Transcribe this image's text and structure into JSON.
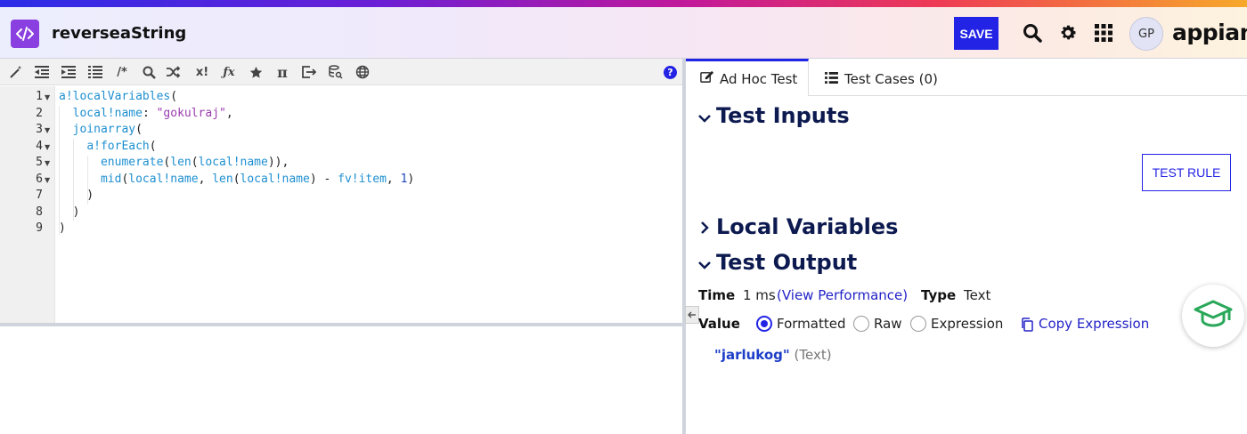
{
  "header": {
    "title": "reverseaString",
    "save_label": "SAVE",
    "avatar_initials": "GP",
    "logo": "appian"
  },
  "toolbar": {
    "icons": [
      "magic-wand-icon",
      "outdent-icon",
      "indent-icon",
      "list-icon",
      "comment-icon",
      "search-icon",
      "shuffle-icon",
      "expression-icon",
      "function-icon",
      "star-icon",
      "pi-icon",
      "export-icon",
      "database-search-icon",
      "globe-icon"
    ],
    "comment_glyph": "/*",
    "expr_glyph": "x!",
    "fx_glyph": "ƒx",
    "pi_glyph": "π",
    "help_glyph": "?"
  },
  "editor": {
    "line_numbers": [
      "1",
      "2",
      "3",
      "4",
      "5",
      "6",
      "7",
      "8",
      "9"
    ],
    "lines": [
      [
        {
          "t": "a!localVariables",
          "c": "kw"
        },
        {
          "t": "(",
          "c": ""
        }
      ],
      [
        {
          "t": "  ",
          "c": ""
        },
        {
          "t": "local!name",
          "c": "kw"
        },
        {
          "t": ": ",
          "c": ""
        },
        {
          "t": "\"gokulraj\"",
          "c": "str"
        },
        {
          "t": ",",
          "c": ""
        }
      ],
      [
        {
          "t": "  ",
          "c": ""
        },
        {
          "t": "joinarray",
          "c": "kw"
        },
        {
          "t": "(",
          "c": ""
        }
      ],
      [
        {
          "t": "    ",
          "c": ""
        },
        {
          "t": "a!forEach",
          "c": "kw"
        },
        {
          "t": "(",
          "c": ""
        }
      ],
      [
        {
          "t": "      ",
          "c": ""
        },
        {
          "t": "enumerate",
          "c": "kw"
        },
        {
          "t": "(",
          "c": ""
        },
        {
          "t": "len",
          "c": "kw"
        },
        {
          "t": "(",
          "c": ""
        },
        {
          "t": "local!name",
          "c": "kw"
        },
        {
          "t": ")),",
          "c": ""
        }
      ],
      [
        {
          "t": "      ",
          "c": ""
        },
        {
          "t": "mid",
          "c": "kw"
        },
        {
          "t": "(",
          "c": ""
        },
        {
          "t": "local!name",
          "c": "kw"
        },
        {
          "t": ", ",
          "c": ""
        },
        {
          "t": "len",
          "c": "kw"
        },
        {
          "t": "(",
          "c": ""
        },
        {
          "t": "local!name",
          "c": "kw"
        },
        {
          "t": ") - ",
          "c": ""
        },
        {
          "t": "fv!item",
          "c": "kw"
        },
        {
          "t": ", ",
          "c": ""
        },
        {
          "t": "1",
          "c": "num"
        },
        {
          "t": ")",
          "c": ""
        }
      ],
      [
        {
          "t": "    )",
          "c": ""
        }
      ],
      [
        {
          "t": "  )",
          "c": ""
        }
      ],
      [
        {
          "t": ")",
          "c": ""
        }
      ]
    ]
  },
  "tabs": {
    "adhoc_label": "Ad Hoc Test",
    "cases_label": "Test Cases (0)"
  },
  "test_inputs": {
    "heading": "Test Inputs",
    "test_rule_label": "TEST RULE"
  },
  "local_variables": {
    "heading": "Local Variables"
  },
  "test_output": {
    "heading": "Test Output",
    "time_label": "Time",
    "time_value": "1 ms",
    "view_performance": "(View Performance)",
    "type_label": "Type",
    "type_value": "Text",
    "value_label": "Value",
    "options": [
      "Formatted",
      "Raw",
      "Expression"
    ],
    "selected_option": "Formatted",
    "copy_expression": "Copy Expression",
    "result_value": "\"jarlukog\"",
    "result_type": "(Text)"
  },
  "colors": {
    "accent": "#2323e6",
    "app_icon": "#8a3fe0",
    "heading": "#0d1a50",
    "keyword": "#1e8fd0",
    "string": "#9a3cae",
    "cap_green": "#2aa85a"
  }
}
